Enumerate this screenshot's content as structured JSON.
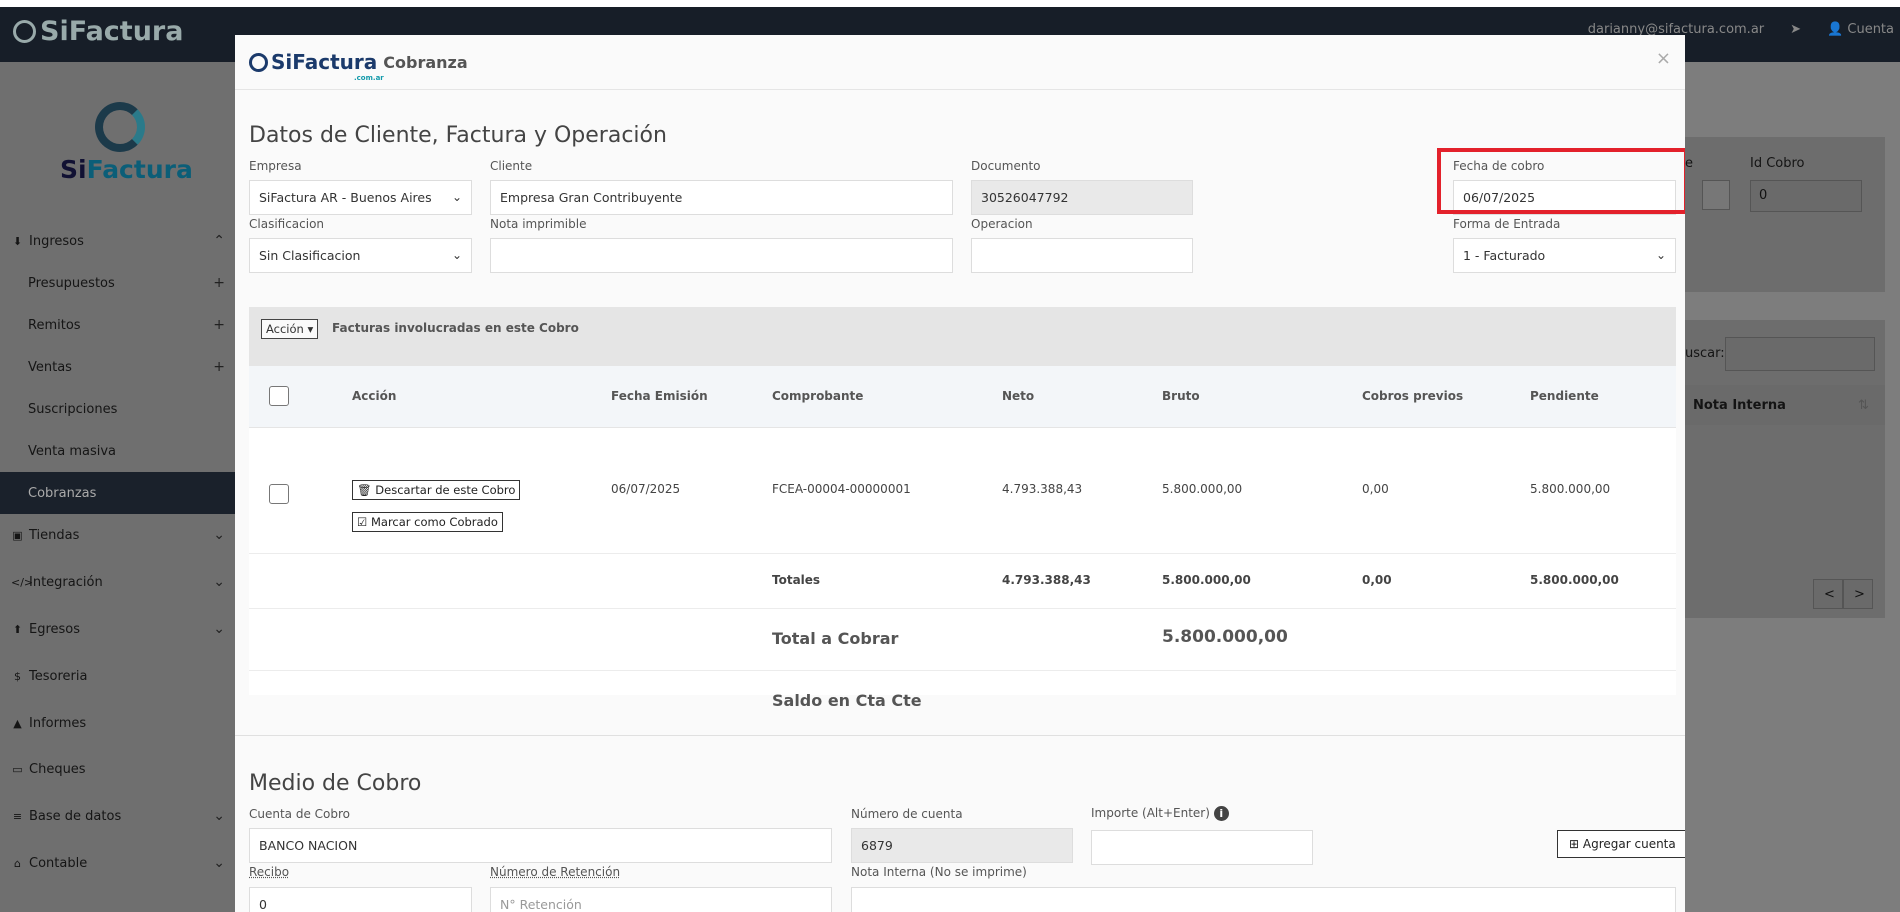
{
  "navbar": {
    "brand": "SiFactura",
    "email": "darianny@sifactura.com.ar",
    "account": "Cuenta"
  },
  "sidebar": {
    "brand_a": "Si",
    "brand_b": "Factura",
    "items": [
      {
        "label": "Ingresos",
        "icon": "download-icon",
        "trail": "⌃"
      },
      {
        "label": "Presupuestos",
        "trail": "+"
      },
      {
        "label": "Remitos",
        "trail": "+"
      },
      {
        "label": "Ventas",
        "trail": "+"
      },
      {
        "label": "Suscripciones",
        "trail": ""
      },
      {
        "label": "Venta masiva",
        "trail": ""
      },
      {
        "label": "Cobranzas",
        "trail": ""
      },
      {
        "label": "Tiendas",
        "icon": "shopping-bag-icon",
        "trail": "⌄"
      },
      {
        "label": "Integración",
        "icon": "code-icon",
        "trail": "⌄"
      },
      {
        "label": "Egresos",
        "icon": "upload-icon",
        "trail": "⌄"
      },
      {
        "label": "Tesoreria",
        "icon": "dollar-icon",
        "trail": ""
      },
      {
        "label": "Informes",
        "icon": "chart-icon",
        "trail": ""
      },
      {
        "label": "Cheques",
        "icon": "credit-card-icon",
        "trail": ""
      },
      {
        "label": "Base de datos",
        "icon": "database-icon",
        "trail": "⌄"
      },
      {
        "label": "Contable",
        "icon": "bank-icon",
        "trail": "⌄"
      }
    ]
  },
  "background": {
    "id_cobro_label": "Id Cobro",
    "id_cobro_value": "0",
    "buscar_label": "uscar:",
    "nota_interna_header": "Nota Interna",
    "prev": "<",
    "next": ">"
  },
  "modal": {
    "logo": "SiFactura",
    "logo_sub": ".com.ar",
    "title": "Cobranza",
    "close": "×",
    "section1_title": "Datos de Cliente, Factura y Operación",
    "fields": {
      "empresa": {
        "label": "Empresa",
        "value": "SiFactura AR - Buenos Aires"
      },
      "cliente": {
        "label": "Cliente",
        "value": "Empresa Gran Contribuyente"
      },
      "documento": {
        "label": "Documento",
        "value": "30526047792"
      },
      "fecha_cobro": {
        "label": "Fecha de cobro",
        "value": "06/07/2025"
      },
      "clasificacion": {
        "label": "Clasificacion",
        "value": "Sin Clasificacion"
      },
      "nota_imprimible": {
        "label": "Nota imprimible",
        "value": ""
      },
      "operacion": {
        "label": "Operacion",
        "value": ""
      },
      "forma_entrada": {
        "label": "Forma de Entrada",
        "value": "1 - Facturado"
      }
    },
    "invoices": {
      "action_button": "Acción",
      "title": "Facturas involucradas en este Cobro",
      "headers": {
        "accion": "Acción",
        "fecha": "Fecha Emisión",
        "comprobante": "Comprobante",
        "neto": "Neto",
        "bruto": "Bruto",
        "cobros_previos": "Cobros previos",
        "pendiente": "Pendiente"
      },
      "row": {
        "descartar": "Descartar de este Cobro",
        "marcar": "Marcar como Cobrado",
        "fecha": "06/07/2025",
        "comprobante": "FCEA-00004-00000001",
        "neto": "4.793.388,43",
        "bruto": "5.800.000,00",
        "cobros_previos": "0,00",
        "pendiente": "5.800.000,00"
      },
      "totals": {
        "label": "Totales",
        "neto": "4.793.388,43",
        "bruto": "5.800.000,00",
        "cobros_previos": "0,00",
        "pendiente": "5.800.000,00"
      },
      "total_cobrar_label": "Total a Cobrar",
      "total_cobrar_value": "5.800.000,00",
      "saldo_label": "Saldo en Cta Cte"
    },
    "section2_title": "Medio de Cobro",
    "medio": {
      "cuenta": {
        "label": "Cuenta de Cobro",
        "value": "BANCO NACION"
      },
      "numero_cuenta": {
        "label": "Número de cuenta",
        "value": "6879"
      },
      "importe": {
        "label": "Importe (Alt+Enter)",
        "value": ""
      },
      "agregar": "Agregar cuenta",
      "recibo": {
        "label": "Recibo",
        "value": "0"
      },
      "retencion": {
        "label": "Número de Retención",
        "placeholder": "N° Retención"
      },
      "nota_interna": {
        "label": "Nota Interna (No se imprime)"
      }
    }
  }
}
